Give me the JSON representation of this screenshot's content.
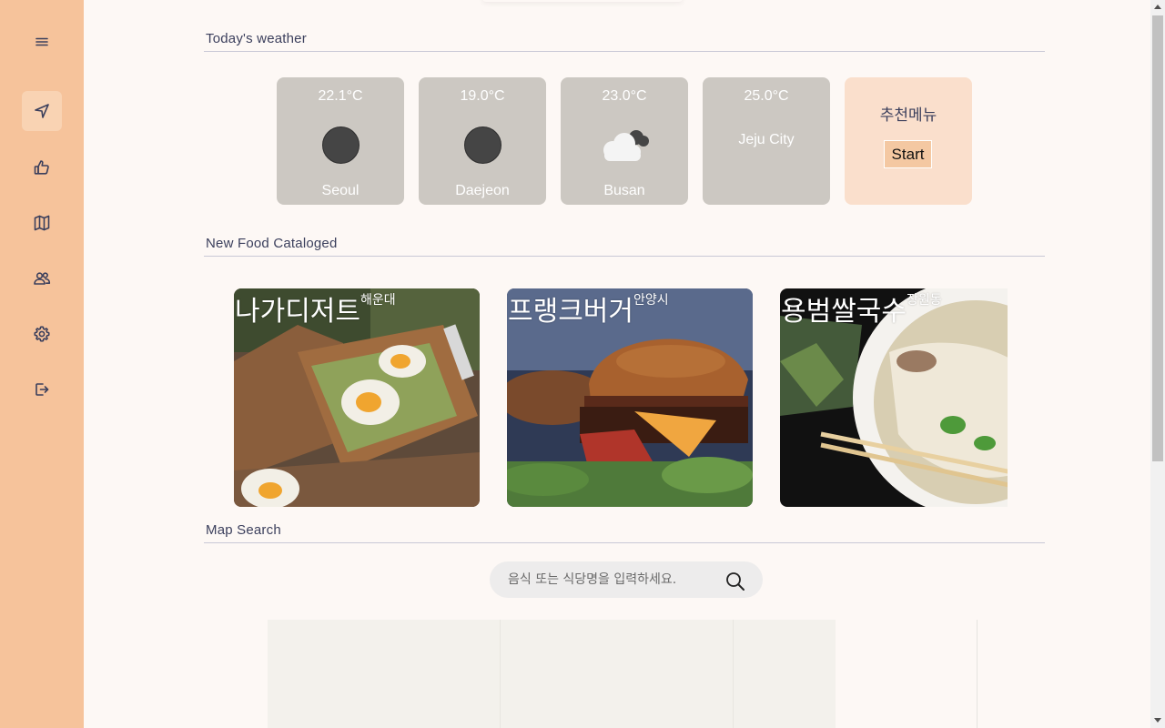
{
  "sidebar": {
    "items": [
      {
        "icon": "hamburger-menu-icon"
      },
      {
        "icon": "navigation-arrow-icon",
        "active": true
      },
      {
        "icon": "thumbs-up-icon"
      },
      {
        "icon": "map-icon"
      },
      {
        "icon": "users-icon"
      },
      {
        "icon": "gear-icon"
      },
      {
        "icon": "logout-icon"
      }
    ],
    "color": "#f6c39b"
  },
  "weather": {
    "title": "Today's weather",
    "cards": [
      {
        "temp": "22.1°C",
        "city": "Seoul",
        "icon": "moon-icon"
      },
      {
        "temp": "19.0°C",
        "city": "Daejeon",
        "icon": "moon-icon"
      },
      {
        "temp": "23.0°C",
        "city": "Busan",
        "icon": "cloudy-night-icon"
      },
      {
        "temp": "25.0°C",
        "city": "Jeju City",
        "icon": ""
      }
    ],
    "recommend": {
      "label": "추천메뉴",
      "button": "Start"
    }
  },
  "food": {
    "title": "New Food Cataloged",
    "items": [
      {
        "name": "나가디저트",
        "area": "해운대"
      },
      {
        "name": "프랭크버거",
        "area": "안양시"
      },
      {
        "name": "용범쌀국수",
        "area": "장원동"
      }
    ]
  },
  "map": {
    "title": "Map Search",
    "search_placeholder": "음식 또는 식당명을 입력하세요."
  }
}
